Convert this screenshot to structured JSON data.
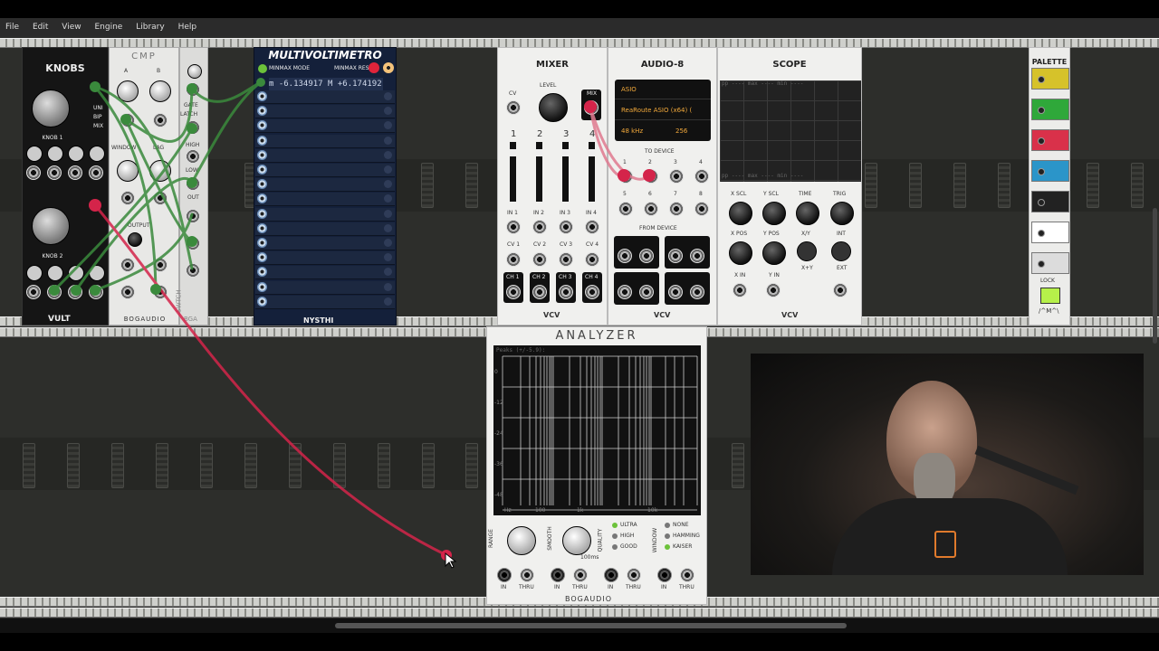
{
  "menubar": {
    "items": [
      "File",
      "Edit",
      "View",
      "Engine",
      "Library",
      "Help"
    ]
  },
  "knobs_module": {
    "title": "KNOBS",
    "knob1": "KNOB 1",
    "knob2": "KNOB 2",
    "uni": "UNI",
    "bip": "BIP",
    "mix": "MIX",
    "brand": "VULT"
  },
  "cmp_module": {
    "title": "CMP",
    "a": "A",
    "b": "B",
    "window": "WINDOW",
    "lag": "LAG",
    "output": "OUTPUT",
    "cv": "CV",
    "brand": "BOGAUDIO"
  },
  "switch_module": {
    "gate": "GATE",
    "latch": "LATCH",
    "high": "HIGH",
    "low": "LOW",
    "out": "OUT",
    "label": "SWTCH",
    "brand": "BGA"
  },
  "multivoltimetro": {
    "title": "MULTIVOLTIMETRO",
    "minmax_mode": "MINMAX MODE",
    "minmax_reset": "MINMAX RESET",
    "reading": "m -6.134917  M +6.174192",
    "brand": "NYSTHI",
    "rows": 15
  },
  "mixer": {
    "title": "MIXER",
    "level": "LEVEL",
    "cv": "CV",
    "mix": "MIX",
    "channels": [
      "1",
      "2",
      "3",
      "4"
    ],
    "in_labels": [
      "IN 1",
      "IN 2",
      "IN 3",
      "IN 4"
    ],
    "cv_labels": [
      "CV 1",
      "CV 2",
      "CV 3",
      "CV 4"
    ],
    "ch_labels": [
      "CH 1",
      "CH 2",
      "CH 3",
      "CH 4"
    ],
    "brand": "VCV"
  },
  "audio8": {
    "title": "AUDIO-8",
    "driver": "ASIO",
    "device": "ReaRoute ASIO (x64) (",
    "sample_rate": "48 kHz",
    "block_size": "256",
    "to_device": "TO DEVICE",
    "from_device": "FROM DEVICE",
    "ports": [
      "1",
      "2",
      "3",
      "4",
      "5",
      "6",
      "7",
      "8"
    ],
    "brand": "VCV"
  },
  "scope": {
    "title": "SCOPE",
    "x_scl": "X SCL",
    "y_scl": "Y SCL",
    "time": "TIME",
    "trig": "TRIG",
    "x_pos": "X POS",
    "y_pos": "Y POS",
    "x_in": "X IN",
    "y_in": "Y IN",
    "xy": "X/Y",
    "xxy": "X+Y",
    "int": "INT",
    "ext": "EXT",
    "hdr": "pp  ----  max  ----  min  ----",
    "brand": "VCV"
  },
  "palette": {
    "title": "PALETTE",
    "lock": "LOCK",
    "brand": "/^M^\\",
    "colors": [
      "#d6c22a",
      "#2fa83a",
      "#d9314a",
      "#2b95c9",
      "#222222",
      "#ffffff",
      "#dcdcdc"
    ]
  },
  "analyzer": {
    "title": "ANALYZER",
    "peaks": "Peaks (+/-5.9):",
    "y_ticks": [
      "0",
      "-12",
      "-24",
      "-36",
      "-48"
    ],
    "x_ticks": [
      "Hz",
      "100",
      "1k",
      "10k"
    ],
    "range": "RANGE",
    "smooth": "SMOOTH",
    "quality": "QUALITY",
    "window": "WINDOW",
    "quality_options": [
      "ULTRA",
      "HIGH",
      "GOOD"
    ],
    "window_options": [
      "NONE",
      "HAMMING",
      "KAISER"
    ],
    "smooth_val": "100ms",
    "in": "IN",
    "thru": "THRU",
    "brand": "BOGAUDIO"
  },
  "colors": {
    "cable_red": "#d4244a",
    "cable_green": "#3a8a3c",
    "accent_led": "#6cc23a"
  }
}
